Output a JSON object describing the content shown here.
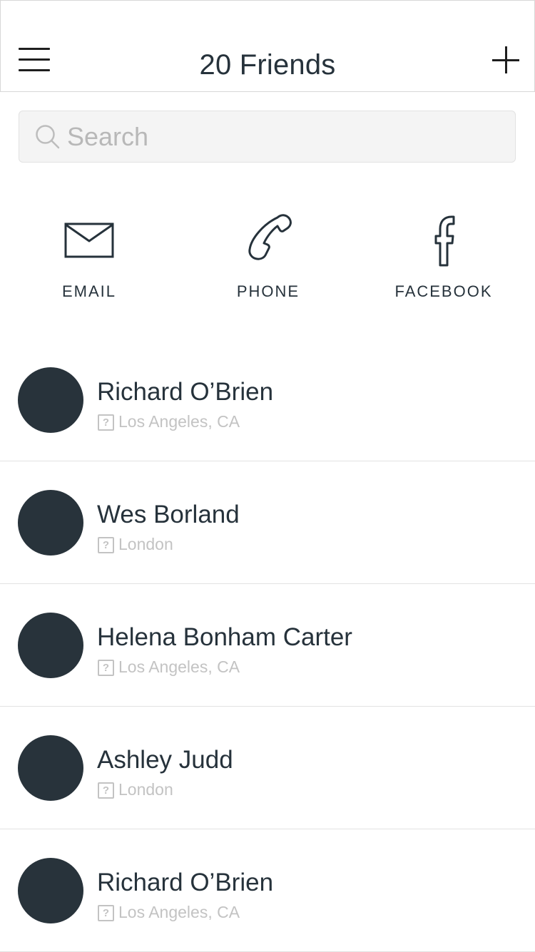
{
  "header": {
    "title": "20 Friends"
  },
  "search": {
    "placeholder": "Search"
  },
  "channels": [
    {
      "label": "EMAIL",
      "icon": "envelope-icon"
    },
    {
      "label": "PHONE",
      "icon": "phone-icon"
    },
    {
      "label": "FACEBOOK",
      "icon": "facebook-icon"
    }
  ],
  "friends": [
    {
      "name": "Richard O’Brien",
      "location": "Los Angeles, CA"
    },
    {
      "name": "Wes Borland",
      "location": "London"
    },
    {
      "name": "Helena Bonham Carter",
      "location": "Los Angeles, CA"
    },
    {
      "name": "Ashley Judd",
      "location": "London"
    },
    {
      "name": "Richard O’Brien",
      "location": "Los Angeles, CA"
    }
  ],
  "colors": {
    "text": "#26323b",
    "avatar": "#28333b",
    "muted": "#c3c3c3",
    "search_bg": "#f4f4f4",
    "divider": "#e3e3e3"
  }
}
